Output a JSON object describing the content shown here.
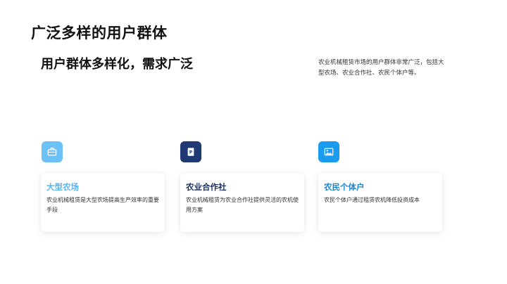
{
  "page": {
    "title": "广泛多样的用户群体",
    "subtitle": "用户群体多样化，需求广泛",
    "intro": "农业机械租赁市场的用户群体非常广泛，包括大型农场、农业合作社、农民个体户等。"
  },
  "cards": [
    {
      "title": "大型农场",
      "description": "农业机械租赁是大型农场提高生产效率的重要手段",
      "title_color": "#5bb3ee",
      "icon": "briefcase-icon",
      "icon_color": "#6cc2f7"
    },
    {
      "title": "农业合作社",
      "description": "农业机械租赁为农业合作社提供灵活的农机使用方案",
      "title_color": "#1c2f5e",
      "icon": "parking-document-icon",
      "icon_color": "#1f3a73"
    },
    {
      "title": "农民个体户",
      "description": "农民个体户通过租赁农机降低投资成本",
      "title_color": "#1a86d0",
      "icon": "image-icon",
      "icon_color": "#1b9bf0"
    }
  ]
}
